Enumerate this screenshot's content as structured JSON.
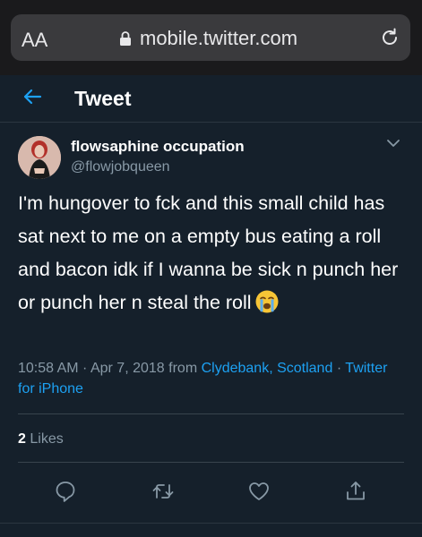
{
  "browser": {
    "aa_label": "AA",
    "url": "mobile.twitter.com"
  },
  "header": {
    "title": "Tweet"
  },
  "tweet": {
    "display_name": "flowsaphine occupation",
    "handle": "@flowjobqueen",
    "text": "I'm hungover to fck and this small child has sat next to me on a empty bus eating a roll and bacon idk if I wanna be sick n punch her or punch her n steal the roll",
    "time": "10:58 AM",
    "date": "Apr 7, 2018",
    "from_word": "from",
    "location": "Clydebank, Scotland",
    "separator": "·",
    "client": "Twitter for iPhone",
    "likes_count": "2",
    "likes_label": "Likes"
  },
  "icons": {
    "back": "back-arrow-icon",
    "reply": "reply-icon",
    "retweet": "retweet-icon",
    "like": "heart-icon",
    "share": "share-icon"
  },
  "colors": {
    "background": "#15202b",
    "accent": "#1da1f2",
    "muted": "#8899a6"
  }
}
